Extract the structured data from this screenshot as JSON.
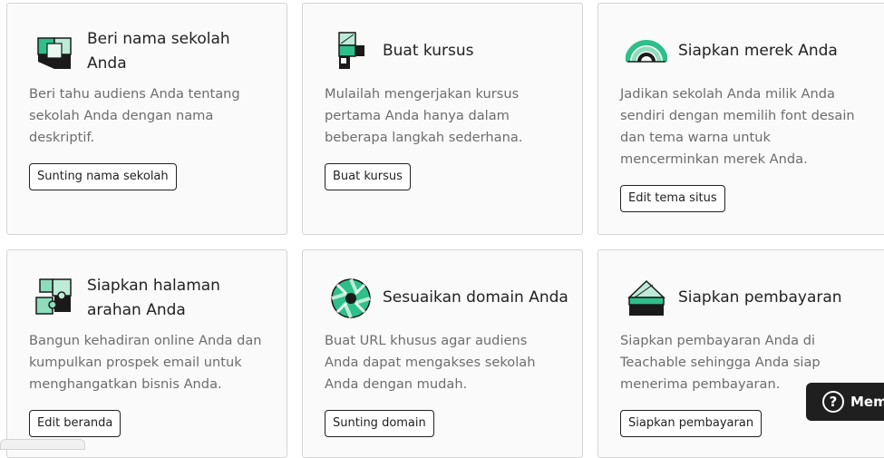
{
  "cards": [
    {
      "title": "Beri nama sekolah Anda",
      "description": "Beri tahu audiens Anda tentang sekolah Anda dengan nama deskriptif.",
      "button": "Sunting nama sekolah",
      "icon": "cube-icon"
    },
    {
      "title": "Buat kursus",
      "description": "Mulailah mengerjakan kursus pertama Anda hanya dalam beberapa langkah sederhana.",
      "button": "Buat kursus",
      "icon": "course-blocks-icon"
    },
    {
      "title": "Siapkan merek Anda",
      "description": "Jadikan sekolah Anda milik Anda sendiri dengan memilih font desain dan tema warna untuk mencerminkan merek Anda.",
      "button": "Edit tema situs",
      "icon": "rainbow-arc-icon"
    },
    {
      "title": "Siapkan halaman arahan Anda",
      "description": "Bangun kehadiran online Anda dan kumpulkan prospek email untuk menghangatkan bisnis Anda.",
      "button": "Edit beranda",
      "icon": "puzzle-icon"
    },
    {
      "title": "Sesuaikan domain Anda",
      "description": "Buat URL khusus agar audiens Anda dapat mengakses sekolah Anda dengan mudah.",
      "button": "Sunting domain",
      "icon": "aperture-icon"
    },
    {
      "title": "Siapkan pembayaran",
      "description": "Siapkan pembayaran Anda di Teachable sehingga Anda siap menerima pembayaran.",
      "button": "Siapkan pembayaran",
      "icon": "cake-slice-icon"
    }
  ],
  "help": {
    "label": "Memb"
  },
  "colors": {
    "accent": "#2fbf8a",
    "dark": "#1f1f1f",
    "border": "#d4d4d4"
  }
}
